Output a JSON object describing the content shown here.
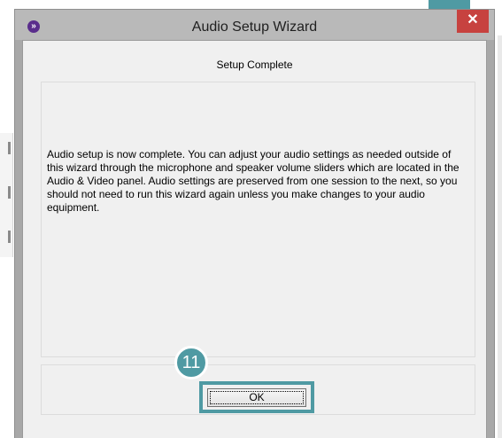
{
  "window": {
    "title": "Audio Setup Wizard",
    "close_glyph": "✕",
    "app_icon_glyph": "»"
  },
  "wizard": {
    "header": "Setup Complete",
    "body": "Audio setup is now complete.  You can adjust your audio settings as needed outside of this wizard through the microphone and speaker volume sliders which are located in the Audio & Video panel. Audio settings are preserved from one session to the next, so you should not need to run this wizard again unless you make changes to your audio equipment.",
    "ok_label": "OK"
  },
  "annotation": {
    "step_number": "11"
  },
  "colors": {
    "accent": "#4f9aa3",
    "close_button": "#c7423f",
    "app_icon": "#5a2d8c"
  }
}
